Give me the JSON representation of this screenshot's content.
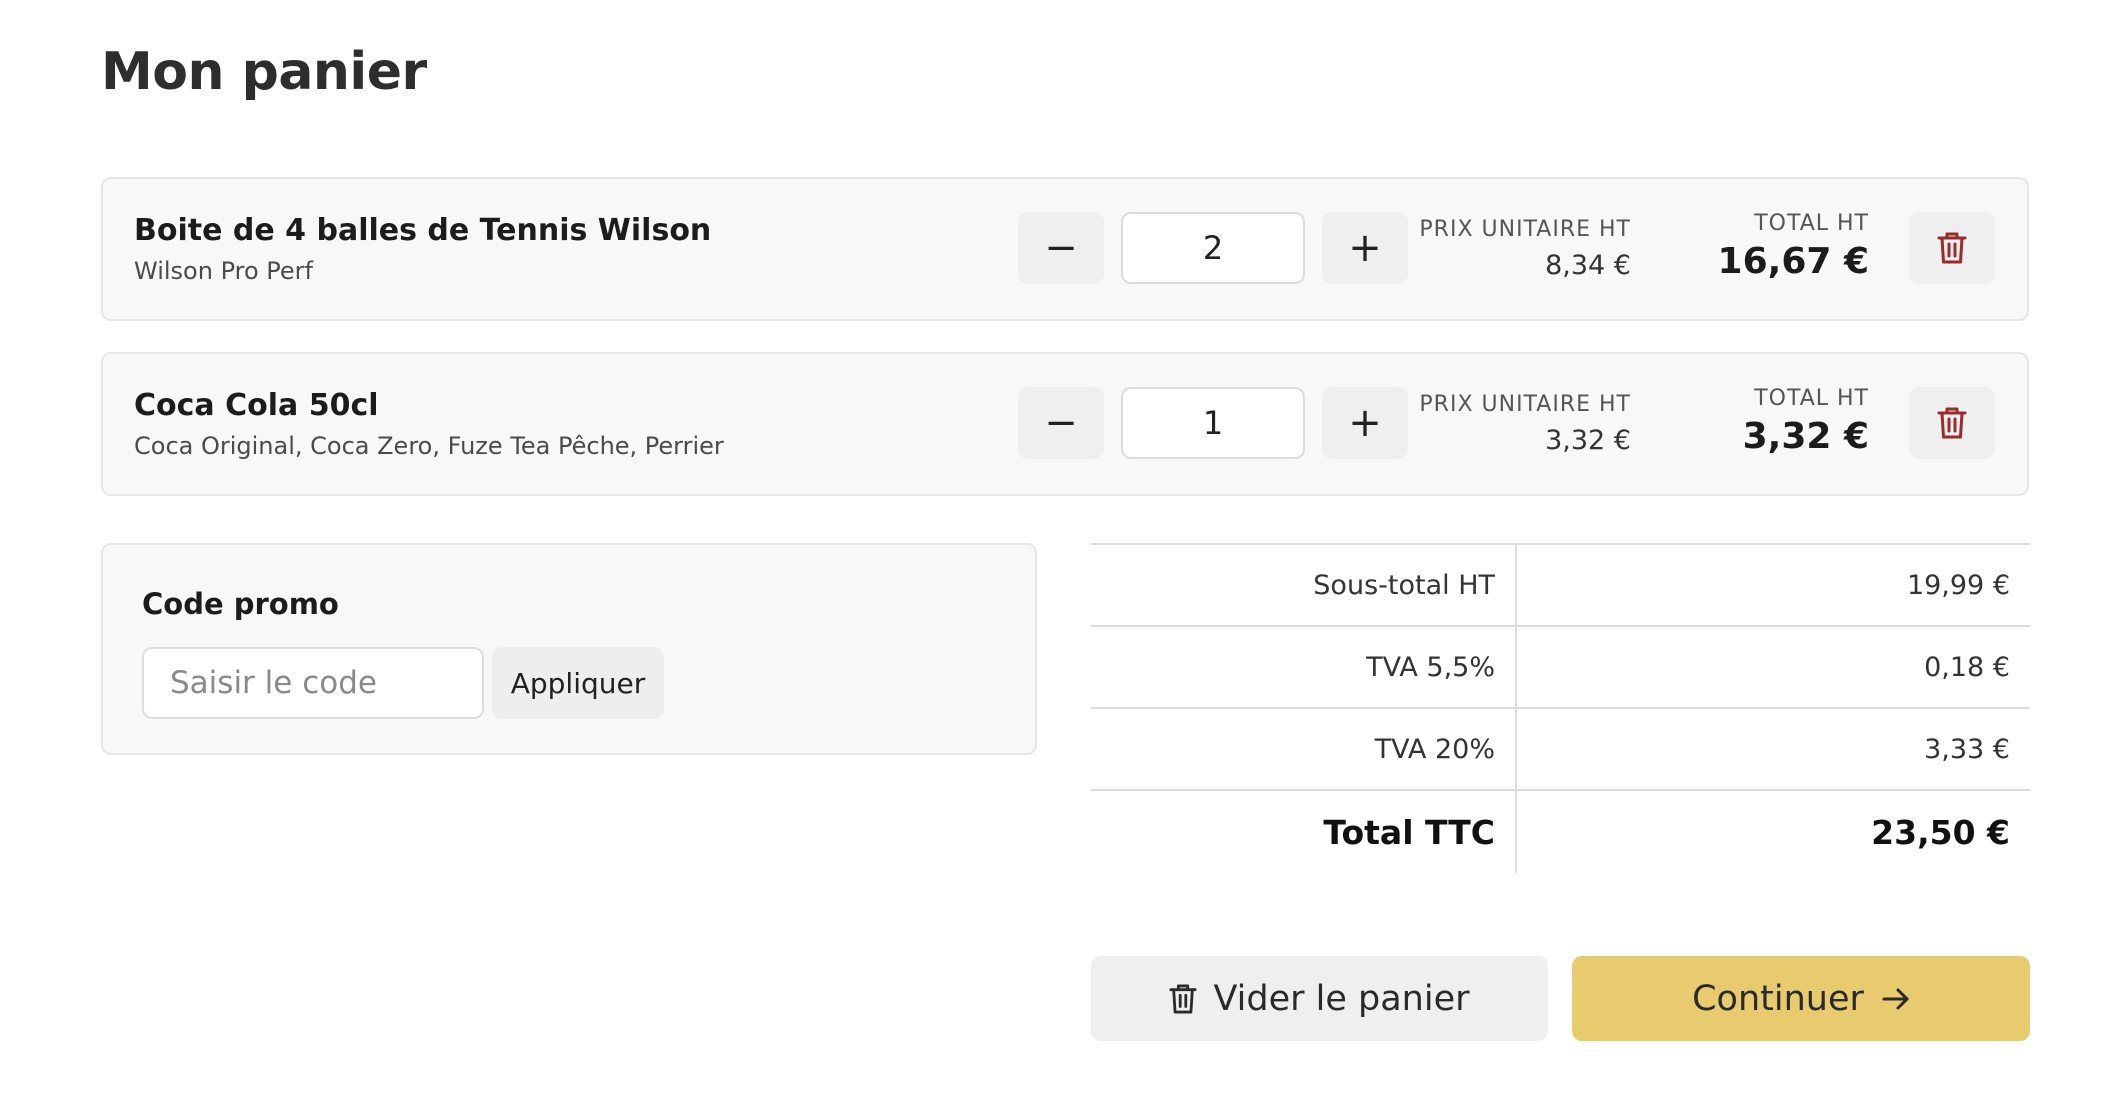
{
  "page": {
    "title": "Mon panier"
  },
  "cart": {
    "items": [
      {
        "name": "Boite de 4 balles de Tennis Wilson",
        "description": "Wilson Pro Perf",
        "quantity": "2",
        "decrement_symbol": "−",
        "increment_symbol": "+",
        "unit_price_label": "PRIX UNITAIRE HT",
        "unit_price": "8,34 €",
        "total_label": "TOTAL HT",
        "total": "16,67 €",
        "delete_icon": "trash-icon"
      },
      {
        "name": "Coca Cola 50cl",
        "description": "Coca Original, Coca Zero, Fuze Tea Pêche, Perrier",
        "quantity": "1",
        "decrement_symbol": "−",
        "increment_symbol": "+",
        "unit_price_label": "PRIX UNITAIRE HT",
        "unit_price": "3,32 €",
        "total_label": "TOTAL HT",
        "total": "3,32 €",
        "delete_icon": "trash-icon"
      }
    ]
  },
  "promo": {
    "title": "Code promo",
    "placeholder": "Saisir le code",
    "value": "",
    "apply_label": "Appliquer"
  },
  "totals": {
    "rows": [
      {
        "label": "Sous-total HT",
        "value": "19,99 €"
      },
      {
        "label": "TVA 5,5%",
        "value": "0,18 €"
      },
      {
        "label": "TVA 20%",
        "value": "3,33 €"
      }
    ],
    "grand": {
      "label": "Total TTC",
      "value": "23,50 €"
    }
  },
  "actions": {
    "clear_label": "Vider le panier",
    "clear_icon": "trash-icon",
    "continue_label": "Continuer",
    "continue_icon": "arrow-right-icon"
  },
  "colors": {
    "accent": "#e8cb6f",
    "delete_icon": "#9b2b2b",
    "card_bg": "#f8f8f8",
    "button_bg": "#efefef"
  }
}
